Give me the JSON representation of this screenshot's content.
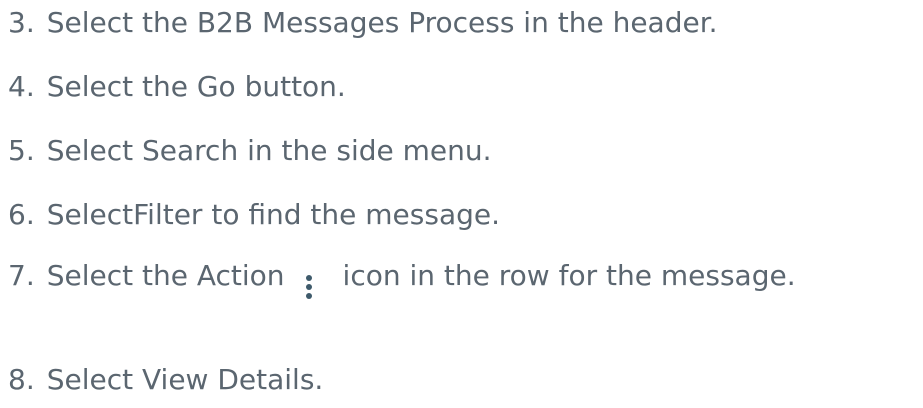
{
  "steps": [
    {
      "number": "3.",
      "text": "Select the B2B Messages Process in the header."
    },
    {
      "number": "4.",
      "text": "Select the Go button."
    },
    {
      "number": "5.",
      "text": "Select Search in the side menu."
    },
    {
      "number": "6.",
      "text": "SelectFilter to find the message."
    },
    {
      "number": "7.",
      "text_before": "Select the Action",
      "icon": "more-vertical-icon",
      "text_after": "icon in the row for the message."
    },
    {
      "number": "8.",
      "text": "Select View Details."
    }
  ],
  "colors": {
    "text": "#5b6670",
    "icon": "#3e5a6b"
  }
}
